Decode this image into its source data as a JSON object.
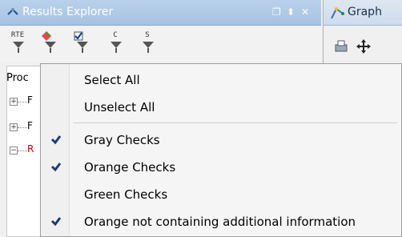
{
  "left_panel": {
    "title": "Results Explorer",
    "controls": [
      "❐",
      "⬍",
      "✕"
    ],
    "toolbar": [
      {
        "label": "RTE",
        "icon": "rte-filter-icon"
      },
      {
        "label": "",
        "icon": "color-filter-icon"
      },
      {
        "label": "",
        "icon": "checked-filter-icon"
      },
      {
        "label": "C",
        "icon": "c-filter-icon"
      },
      {
        "label": "S",
        "icon": "s-filter-icon"
      }
    ],
    "tree_header": "Proc",
    "tree_nodes": [
      {
        "expander": "+",
        "letter": "F",
        "color": "#000000"
      },
      {
        "expander": "+",
        "letter": "F",
        "color": "#000000"
      },
      {
        "expander": "−",
        "letter": "R",
        "color": "#cc0000"
      }
    ]
  },
  "right_panel": {
    "title": "Graph"
  },
  "menu": {
    "items": [
      {
        "label": "Select All",
        "checked": false
      },
      {
        "label": "Unselect All",
        "checked": false
      },
      {
        "label": "Gray Checks",
        "checked": true
      },
      {
        "label": "Orange Checks",
        "checked": true
      },
      {
        "label": "Green Checks",
        "checked": false
      },
      {
        "label": "Orange not containing additional information",
        "checked": true
      }
    ]
  },
  "colors": {
    "title_bar": "#a7c2e2",
    "check": "#1b3d7a",
    "accent_red": "#cc0000"
  }
}
